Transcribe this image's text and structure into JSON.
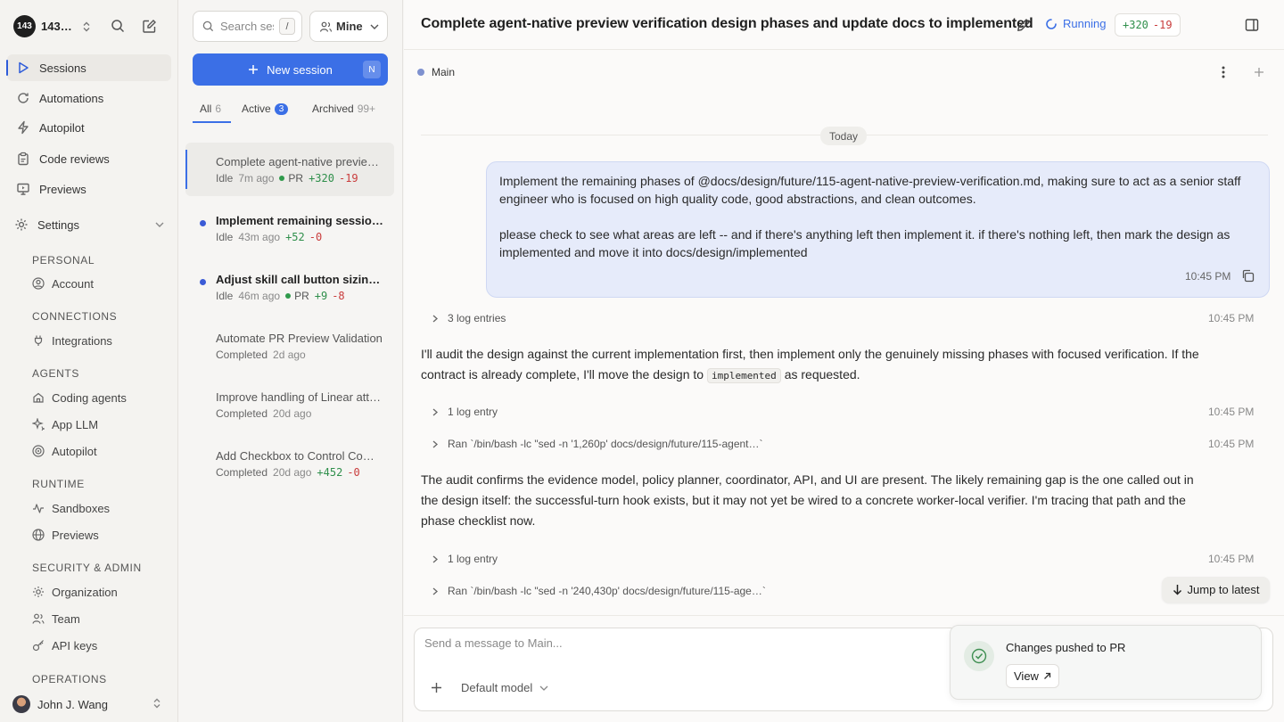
{
  "workspace": {
    "logo_text": "143",
    "name": "143…"
  },
  "nav": [
    {
      "label": "Sessions",
      "icon": "play-icon",
      "active": true
    },
    {
      "label": "Automations",
      "icon": "refresh-icon"
    },
    {
      "label": "Autopilot",
      "icon": "bolt-icon"
    },
    {
      "label": "Code reviews",
      "icon": "clipboard-icon"
    },
    {
      "label": "Previews",
      "icon": "monitor-icon"
    }
  ],
  "settings": {
    "label": "Settings"
  },
  "sections": {
    "personal": "PERSONAL",
    "connections": "CONNECTIONS",
    "agents": "AGENTS",
    "runtime": "RUNTIME",
    "security": "SECURITY & ADMIN",
    "operations": "OPERATIONS"
  },
  "settings_items": {
    "account": "Account",
    "integrations": "Integrations",
    "coding_agents": "Coding agents",
    "app_llm": "App LLM",
    "autopilot": "Autopilot",
    "sandboxes": "Sandboxes",
    "previews": "Previews",
    "organization": "Organization",
    "team": "Team",
    "api_keys": "API keys"
  },
  "user": {
    "name": "John J. Wang"
  },
  "list": {
    "search_placeholder": "Search sessions",
    "search_kbd": "/",
    "filter": "Mine",
    "new_session": "New session",
    "new_session_kbd": "N",
    "tabs": {
      "all": {
        "label": "All",
        "count": "6"
      },
      "active": {
        "label": "Active",
        "count": "3"
      },
      "archived": {
        "label": "Archived",
        "count": "99+"
      }
    },
    "sessions": [
      {
        "title": "Complete agent-native preview verification design phases",
        "status": "Idle",
        "age": "7m ago",
        "pr": "PR",
        "add": "+320",
        "del": "-19"
      },
      {
        "title": "Implement remaining session features",
        "status": "Idle",
        "age": "43m ago",
        "add": "+52",
        "del": "-0"
      },
      {
        "title": "Adjust skill call button sizing and spacing",
        "status": "Idle",
        "age": "46m ago",
        "pr": "PR",
        "add": "+9",
        "del": "-8"
      },
      {
        "title": "Automate PR Preview Validation",
        "status": "Completed",
        "age": "2d ago"
      },
      {
        "title": "Improve handling of Linear attachments",
        "status": "Completed",
        "age": "20d ago"
      },
      {
        "title": "Add Checkbox to Control Comments",
        "status": "Completed",
        "age": "20d ago",
        "add": "+452",
        "del": "-0"
      }
    ]
  },
  "main": {
    "title": "Complete agent-native preview verification design phases and update docs to implemented",
    "status": "Running",
    "diff_add": "+320",
    "diff_del": "-19",
    "branch": "Main",
    "day": "Today",
    "user_msg": {
      "p1": "Implement the remaining phases of @docs/design/future/115-agent-native-preview-verification.md, making sure to act as a senior staff engineer who is focused on high quality code, good abstractions, and clean outcomes.",
      "p2": "please check to see what areas are left -- and if there's anything left then implement it. if there's nothing left, then mark the design as implemented and move it into docs/design/implemented",
      "time": "10:45 PM"
    },
    "log1": {
      "label": "3 log entries",
      "time": "10:45 PM"
    },
    "reply1": {
      "before": "I'll audit the design against the current implementation first, then implement only the genuinely missing phases with focused verification. If the contract is already complete, I'll move the design to",
      "code": "implemented",
      "after": "as requested."
    },
    "log2": {
      "label": "1 log entry",
      "time": "10:45 PM"
    },
    "cmd1": {
      "label": "Ran `/bin/bash -lc \"sed -n '1,260p' docs/design/future/115-agent…`",
      "time": "10:45 PM"
    },
    "reply2": "The audit confirms the evidence model, policy planner, coordinator, API, and UI are present. The likely remaining gap is the one called out in the design itself: the successful-turn hook exists, but it may not yet be wired to a concrete worker-local verifier. I'm tracing that path and the phase checklist now.",
    "log3": {
      "label": "1 log entry",
      "time": "10:45 PM"
    },
    "cmd2": {
      "label": "Ran `/bin/bash -lc \"sed -n '240,430p' docs/design/future/115-age…`"
    },
    "jump": "Jump to latest",
    "composer_placeholder": "Send a message to Main...",
    "model": "Default model"
  },
  "toast": {
    "title": "Changes pushed to PR",
    "view": "View"
  }
}
